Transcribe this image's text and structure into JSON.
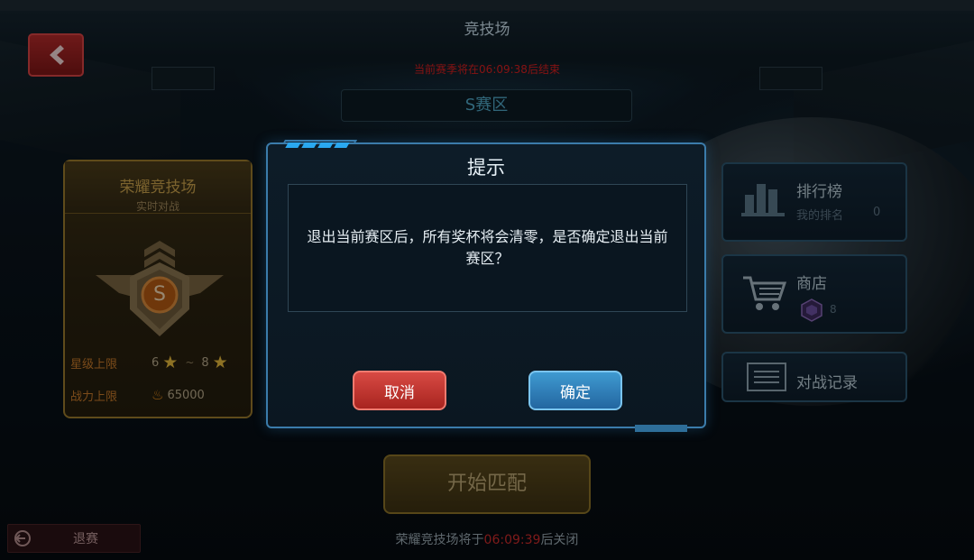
{
  "header": {
    "title": "竞技场",
    "season_notice": "当前赛季将在06:09:38后结束",
    "zone_title": "S赛区"
  },
  "arena_card": {
    "name": "荣耀竞技场",
    "subtitle": "实时对战",
    "emblem_letter": "S",
    "star_limit_label": "星级上限",
    "star_min": "6",
    "star_max": "8",
    "power_limit_label": "战力上限",
    "power_value": "65000"
  },
  "side_menu": {
    "leaderboard_label": "排行榜",
    "my_rank_label": "我的排名",
    "my_rank_value": "0",
    "shop_label": "商店",
    "gem_count": "8",
    "battle_record_label": "对战记录"
  },
  "bottom": {
    "quit_label": "退赛",
    "match_label": "开始匹配",
    "close_prefix": "荣耀竞技场将于",
    "close_time": "06:09:39",
    "close_suffix": "后关闭"
  },
  "dialog": {
    "title": "提示",
    "message": "退出当前赛区后，所有奖杯将会清零，是否确定退出当前赛区？",
    "cancel_label": "取消",
    "confirm_label": "确定"
  },
  "icons": {
    "back": "back-arrow-icon",
    "leaderboard": "bar-chart-icon",
    "shop": "shopping-cart-icon",
    "gem": "gem-icon",
    "record": "list-icon",
    "quit": "exit-icon",
    "star": "star-icon",
    "flame": "flame-icon"
  },
  "colors": {
    "accent_blue": "#3b7cab",
    "cancel_red": "#c0342e",
    "confirm_blue": "#2f80bb",
    "gold": "#9a7a2c",
    "warning_red": "#d81f1f"
  }
}
